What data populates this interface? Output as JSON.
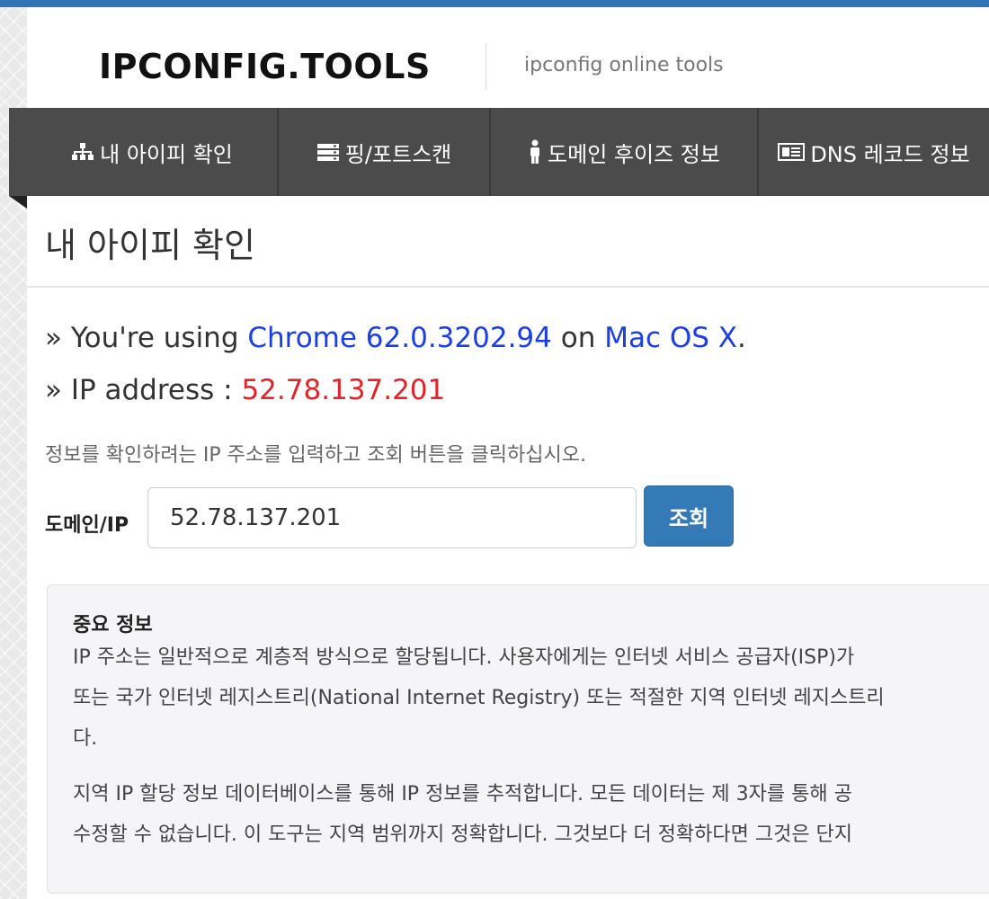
{
  "header": {
    "logo": "IPCONFIG.TOOLS",
    "tagline": "ipconfig online tools"
  },
  "nav": {
    "items": [
      {
        "label": "내 아이피 확인",
        "icon": "sitemap-icon"
      },
      {
        "label": "핑/포트스캔",
        "icon": "server-icon"
      },
      {
        "label": "도메인 후이즈 정보",
        "icon": "person-icon"
      },
      {
        "label": "DNS 레코드 정보",
        "icon": "newspaper-icon"
      }
    ]
  },
  "page": {
    "title": "내 아이피 확인"
  },
  "info": {
    "using_prefix": "» You're using ",
    "browser": "Chrome 62.0.3202.94",
    "on": " on ",
    "os": "Mac OS X",
    "period": ".",
    "ip_prefix": "» IP address : ",
    "ip": "52.78.137.201"
  },
  "lookup": {
    "hint": "정보를 확인하려는 IP 주소를 입력하고 조회 버튼을 클릭하십시오.",
    "label": "도메인/IP",
    "value": "52.78.137.201",
    "button": "조회"
  },
  "notice": {
    "title": "중요 정보",
    "p1_line1": "IP 주소는 일반적으로 계층적 방식으로 할당됩니다. 사용자에게는 인터넷 서비스 공급자(ISP)가",
    "p1_line2": "또는 국가 인터넷 레지스트리(National Internet Registry) 또는 적절한 지역 인터넷 레지스트리",
    "p1_line3": "다.",
    "p2_line1": "지역 IP 할당 정보 데이터베이스를 통해 IP 정보를 추적합니다. 모든 데이터는 제 3자를 통해 공",
    "p2_line2": "수정할 수 없습니다. 이 도구는 지역 범위까지 정확합니다. 그것보다 더 정확하다면 그것은 단지"
  },
  "colors": {
    "accent": "#2f74b5",
    "nav_bg": "#4b4b4b",
    "link": "#1a3fe6",
    "ip": "#e2232a",
    "button": "#337ab7"
  }
}
